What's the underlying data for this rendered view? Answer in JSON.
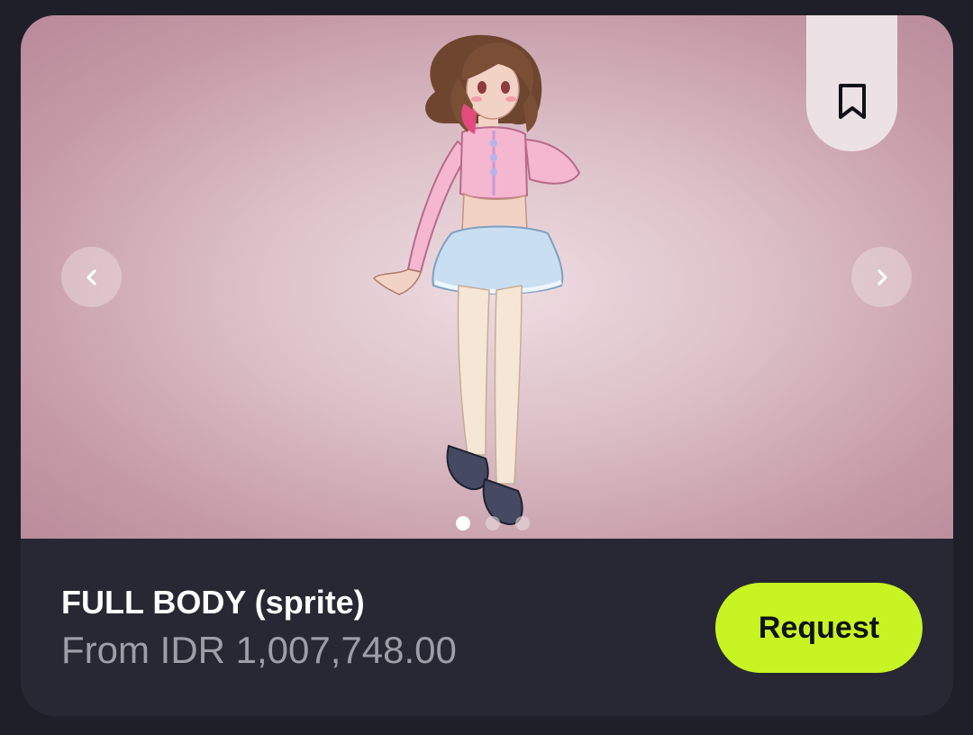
{
  "product": {
    "title": "FULL BODY (sprite)",
    "price": "From IDR 1,007,748.00"
  },
  "actions": {
    "request_label": "Request"
  },
  "gallery": {
    "image_count": 3,
    "active_index": 0,
    "image_subject": "full-body anime-style character sprite"
  },
  "icons": {
    "bookmark": "bookmark-icon",
    "prev": "chevron-left-icon",
    "next": "chevron-right-icon"
  },
  "colors": {
    "page_background": "#1e1f28",
    "card_background": "#272833",
    "accent": "#c8f423",
    "title_text": "#ffffff",
    "price_text": "#9c9ea8"
  }
}
